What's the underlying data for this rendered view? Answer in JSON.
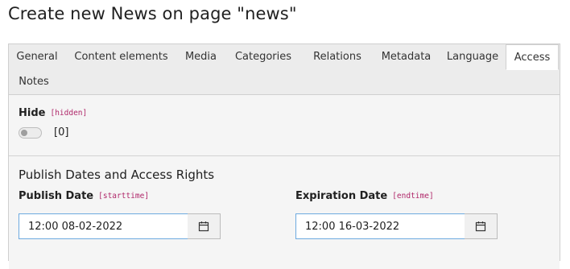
{
  "page": {
    "title": "Create new News on page \"news\""
  },
  "tabs": [
    {
      "label": "General",
      "active": false
    },
    {
      "label": "Content elements",
      "active": false
    },
    {
      "label": "Media",
      "active": false
    },
    {
      "label": "Categories",
      "active": false
    },
    {
      "label": "Relations",
      "active": false
    },
    {
      "label": "Metadata",
      "active": false
    },
    {
      "label": "Language",
      "active": false
    },
    {
      "label": "Access",
      "active": true
    },
    {
      "label": "Notes",
      "active": false
    }
  ],
  "hide_field": {
    "label": "Hide",
    "code": "[hidden]",
    "value_text": "[0]",
    "checked": false
  },
  "dates_section": {
    "heading": "Publish Dates and Access Rights",
    "publish": {
      "label": "Publish Date",
      "code": "[starttime]",
      "value": "12:00 08-02-2022",
      "button_icon": "calendar-icon"
    },
    "expiration": {
      "label": "Expiration Date",
      "code": "[endtime]",
      "value": "12:00 16-03-2022",
      "button_icon": "calendar-icon"
    }
  },
  "colors": {
    "code_accent": "#b0286a",
    "input_focus_border": "#6daae0",
    "panel_background": "#f5f5f5",
    "tab_bar_background": "#ececec"
  }
}
